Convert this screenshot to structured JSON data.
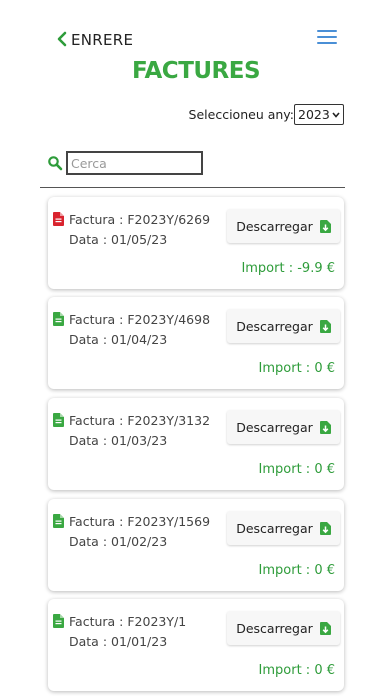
{
  "header": {
    "back_label": "ENRERE",
    "title": "FACTURES"
  },
  "filter": {
    "year_label": "Seleccioneu any:",
    "year_value": "2023"
  },
  "search": {
    "placeholder": "Cerca"
  },
  "colors": {
    "accent": "#3aa842",
    "danger": "#d9232e",
    "menu": "#4a8fd6"
  },
  "invoices": [
    {
      "number": "Factura : F2023Y/6269",
      "date": "Data : 01/05/23",
      "button": "Descarregar",
      "amount": "Import : -9.9 €",
      "icon": "pdf-red-icon"
    },
    {
      "number": "Factura : F2023Y/4698",
      "date": "Data : 01/04/23",
      "button": "Descarregar",
      "amount": "Import : 0 €",
      "icon": "pdf-green-icon"
    },
    {
      "number": "Factura : F2023Y/3132",
      "date": "Data : 01/03/23",
      "button": "Descarregar",
      "amount": "Import : 0 €",
      "icon": "pdf-green-icon"
    },
    {
      "number": "Factura : F2023Y/1569",
      "date": "Data : 01/02/23",
      "button": "Descarregar",
      "amount": "Import : 0 €",
      "icon": "pdf-green-icon"
    },
    {
      "number": "Factura : F2023Y/1",
      "date": "Data : 01/01/23",
      "button": "Descarregar",
      "amount": "Import : 0 €",
      "icon": "pdf-green-icon"
    }
  ]
}
